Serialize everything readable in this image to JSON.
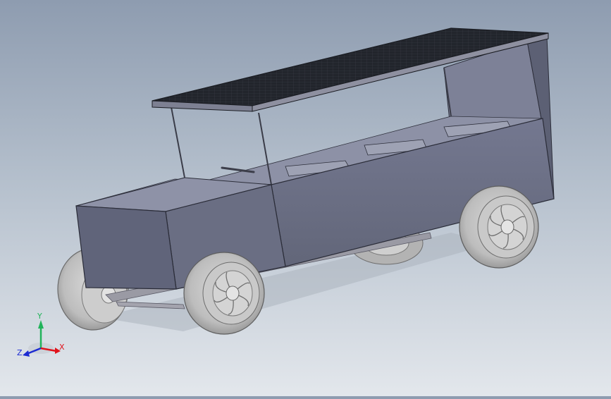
{
  "scene": {
    "colors": {
      "body_panel": "#6d7186",
      "body_dark": "#5e6276",
      "body_top": "#8a8ea2",
      "interior": "#7a7e92",
      "solar_panel": "#252830",
      "solar_frame": "#7a7d8c",
      "tire": "#b9b9b9",
      "hub": "#d6d6d6",
      "shadow": "#a8aeb8"
    }
  },
  "triad": {
    "x_label": "X",
    "y_label": "Y",
    "z_label": "Z",
    "x_color": "#e0131b",
    "y_color": "#21b35a",
    "z_color": "#1c2bd1"
  }
}
